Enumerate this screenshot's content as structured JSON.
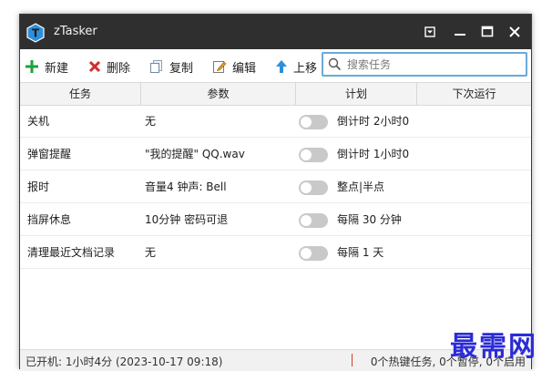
{
  "window": {
    "title": "zTasker"
  },
  "toolbar": {
    "new_label": "新建",
    "delete_label": "删除",
    "copy_label": "复制",
    "edit_label": "编辑",
    "move_up_label": "上移",
    "search_placeholder": "搜索任务"
  },
  "table": {
    "headers": [
      "任务",
      "参数",
      "计划",
      "下次运行"
    ],
    "rows": [
      {
        "task": "关机",
        "param": "无",
        "enabled": false,
        "plan": "倒计时 2小时0",
        "next": ""
      },
      {
        "task": "弹窗提醒",
        "param": "\"我的提醒\" QQ.wav",
        "enabled": false,
        "plan": "倒计时 1小时0",
        "next": ""
      },
      {
        "task": "报时",
        "param": "音量4 钟声: Bell",
        "enabled": false,
        "plan": "整点|半点",
        "next": ""
      },
      {
        "task": "挡屏休息",
        "param": "10分钟 密码可退",
        "enabled": false,
        "plan": "每隔 30 分钟",
        "next": ""
      },
      {
        "task": "清理最近文档记录",
        "param": "无",
        "enabled": false,
        "plan": "每隔 1 天",
        "next": ""
      }
    ]
  },
  "status": {
    "uptime": "已开机: 1小时4分 (2023-10-17 09:18)",
    "summary": "0个热键任务, 0个暂停, 0个启用"
  },
  "watermark": "最需网",
  "colors": {
    "titlebar": "#2f2f2f",
    "accent_blue": "#2d8fd9",
    "new_green": "#1aa33a",
    "delete_red": "#d42a2a",
    "toggle_off": "#c9c9c9"
  }
}
